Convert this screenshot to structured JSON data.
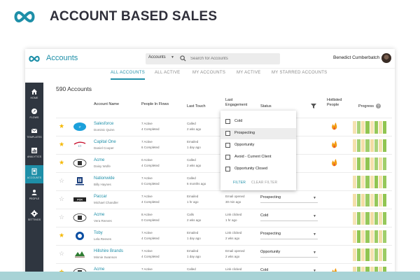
{
  "hero": {
    "title": "ACCOUNT BASED SALES"
  },
  "app": {
    "title": "Accounts",
    "search": {
      "select_value": "Accounts",
      "placeholder": "Search for Accounts"
    },
    "user": {
      "name": "Benedict Cumberbatch"
    },
    "tabs": [
      {
        "label": "ALL ACCOUNTS",
        "active": true
      },
      {
        "label": "ALL ACTIVE"
      },
      {
        "label": "MY ACCOUNTS"
      },
      {
        "label": "MY ACTIVE"
      },
      {
        "label": "MY STARRED ACCOUNTS"
      }
    ],
    "sidebar": [
      {
        "label": "HOME",
        "icon": "home-icon"
      },
      {
        "label": "FLOWS",
        "icon": "flows-icon"
      },
      {
        "label": "TEMPLATES",
        "icon": "templates-icon"
      },
      {
        "label": "ANALYTICS",
        "icon": "analytics-icon"
      },
      {
        "label": "ACCOUNTS",
        "icon": "accounts-icon",
        "active": true
      },
      {
        "label": "PEOPLE",
        "icon": "people-icon"
      },
      {
        "label": "SETTINGS",
        "icon": "settings-icon"
      }
    ],
    "count_label": "590 Accounts",
    "columns": {
      "account_name": "Account Name",
      "people_in_flows": "People In Flows",
      "last_touch": "Last Touch",
      "last_engagement": "Last Engagement",
      "status": "Status",
      "hotlisted_people": "Hotlisted People",
      "progress": "Progress"
    },
    "rows": [
      {
        "name": "Salesforce",
        "contact": "Dominic Quinn",
        "flow_active": "7 Active",
        "flow_completed": "4 Completed",
        "touch_type": "Called",
        "touch_time": "2 wks ago",
        "eng_type": "Link clicked",
        "eng_time": "3 hrs ago",
        "status": "",
        "starred": true,
        "hotlisted": true,
        "logo": "salesforce-logo",
        "progress": [
          0.6,
          0.4,
          0.7,
          0.9,
          0.5,
          0.8,
          0.6,
          0.9
        ]
      },
      {
        "name": "Capital One",
        "contact": "Daniel Cooper",
        "flow_active": "7 Active",
        "flow_completed": "6 Completed",
        "touch_type": "Emailed",
        "touch_time": "1 day ago",
        "eng_type": "Link clicked",
        "eng_time": "2 wks ago",
        "status": "",
        "starred": true,
        "hotlisted": true,
        "logo": "capital-one-logo",
        "progress": [
          0.7,
          0.5,
          0.8,
          0.6,
          0.9,
          0.4,
          0.7,
          0.9
        ]
      },
      {
        "name": "Acme",
        "contact": "Daisy Wolfe",
        "flow_active": "0 Active",
        "flow_completed": "4 Completed",
        "touch_type": "Called",
        "touch_time": "2 wks ago",
        "eng_type": "Link clicked",
        "eng_time": "2 wks ago",
        "status": "",
        "starred": true,
        "hotlisted": true,
        "logo": "acme-logo",
        "progress": [
          0.5,
          0.8,
          0.6,
          0.9,
          0.7,
          0.5,
          0.8,
          0.6
        ]
      },
      {
        "name": "Nationwide",
        "contact": "Billy Haynes",
        "flow_active": "7 Active",
        "flow_completed": "0 Completed",
        "touch_type": "Called",
        "touch_time": "6 months ago",
        "eng_type": "Link clicked",
        "eng_time": "2 wks ago",
        "status": "",
        "starred": false,
        "hotlisted": false,
        "logo": "nationwide-logo",
        "progress": [
          0.6,
          0.7,
          0.5,
          0.8,
          0.6,
          0.9,
          0.7,
          0.8
        ]
      },
      {
        "name": "Paccar",
        "contact": "Michael Chandler",
        "flow_active": "7 Active",
        "flow_completed": "4 Completed",
        "touch_type": "Emailed",
        "touch_time": "1 hr ago",
        "eng_type": "Email opened",
        "eng_time": "30 min ago",
        "status": "Prospecting",
        "starred": false,
        "hotlisted": false,
        "logo": "paccar-logo",
        "progress": [
          0.8,
          0.6,
          0.9,
          0.7,
          0.5,
          0.8,
          0.6,
          0.9
        ]
      },
      {
        "name": "Acme",
        "contact": "Vera Reeves",
        "flow_active": "8 Active",
        "flow_completed": "0 Completed",
        "touch_type": "Calls",
        "touch_time": "2 wks ago",
        "eng_type": "Link clicked",
        "eng_time": "1 hr ago",
        "status": "Cold",
        "starred": false,
        "hotlisted": false,
        "logo": "acme-logo",
        "progress": [
          0.5,
          0.7,
          0.6,
          0.8,
          0.9,
          0.6,
          0.7,
          0.8
        ]
      },
      {
        "name": "Toby",
        "contact": "Lela Reeves",
        "flow_active": "7 Active",
        "flow_completed": "4 Completed",
        "touch_type": "Emailed",
        "touch_time": "1 day ago",
        "eng_type": "Link clicked",
        "eng_time": "2 wks ago",
        "status": "Prospecting",
        "starred": true,
        "hotlisted": false,
        "logo": "toby-logo",
        "progress": [
          0.7,
          0.9,
          0.6,
          0.8,
          0.5,
          0.7,
          0.9,
          0.6
        ]
      },
      {
        "name": "Hillshire Brands",
        "contact": "Minnie Swanson",
        "flow_active": "7 Active",
        "flow_completed": "4 Completed",
        "touch_type": "Emailed",
        "touch_time": "1 day ago",
        "eng_type": "Email opened",
        "eng_time": "2 wks ago",
        "status": "Opportunity",
        "starred": false,
        "hotlisted": false,
        "logo": "hillshire-logo",
        "progress": [
          0.6,
          0.8,
          0.7,
          0.9,
          0.6,
          0.5,
          0.8,
          0.7
        ]
      },
      {
        "name": "Acme",
        "contact": "Cornelia Hill",
        "flow_active": "7 Active",
        "flow_completed": "4 Completed",
        "touch_type": "Called",
        "touch_time": "2 wks ago",
        "eng_type": "Link clicked",
        "eng_time": "2 wks ago",
        "status": "Cold",
        "starred": true,
        "hotlisted": true,
        "logo": "acme-logo",
        "progress": [
          0.8,
          0.6,
          0.7,
          0.9,
          0.7,
          0.8,
          0.6,
          0.9
        ]
      }
    ],
    "status_dropdown": {
      "options": [
        {
          "label": "Cold",
          "highlighted": false
        },
        {
          "label": "Prospecting",
          "highlighted": true
        },
        {
          "label": "Opportunity",
          "highlighted": false
        },
        {
          "label": "Avoid - Current Client",
          "highlighted": false
        },
        {
          "label": "Opportunity Closed",
          "highlighted": false
        }
      ],
      "filter_label": "FILTER",
      "clear_label": "CLEAR FILTER"
    }
  },
  "colors": {
    "accent": "#1e8fa8",
    "sidebar": "#2f3640",
    "star": "#f5b800",
    "progress_green": "#8bc34a",
    "progress_tan": "#f3dca0"
  }
}
